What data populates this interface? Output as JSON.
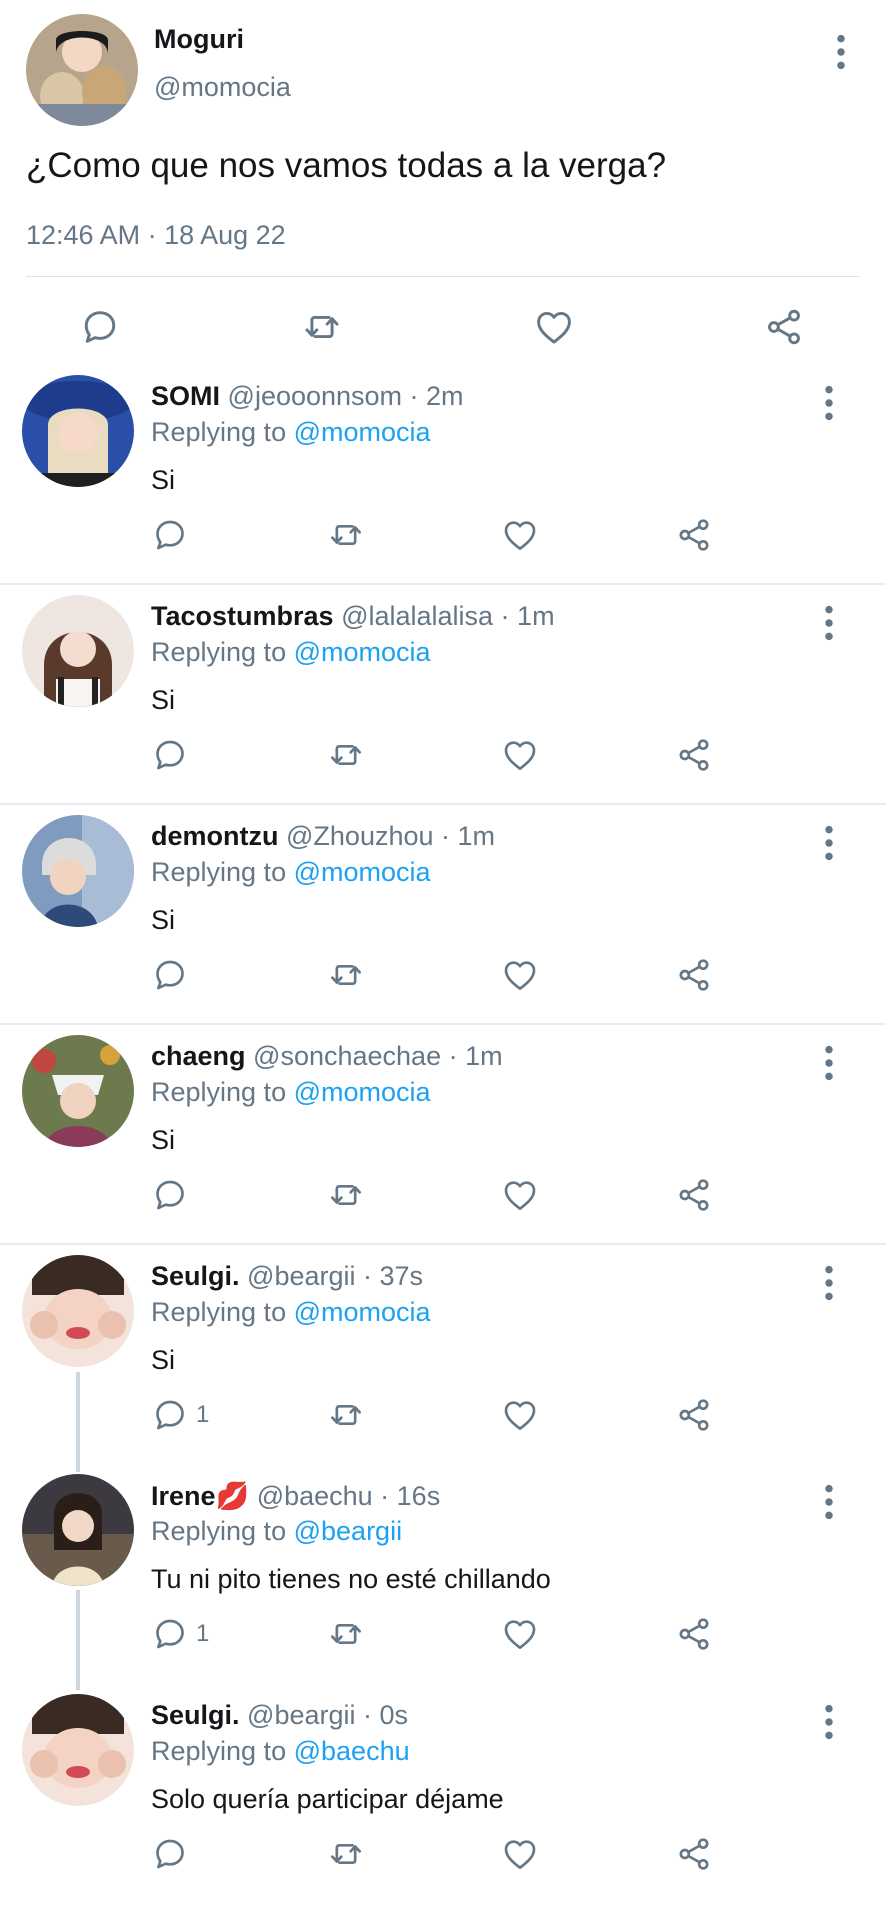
{
  "main_tweet": {
    "name": "Moguri",
    "handle": "@momocia",
    "text": "¿Como que nos vamos todas a la verga?",
    "timestamp": "12:46 AM · 18 Aug 22",
    "icons": [
      "comment-icon",
      "retweet-icon",
      "like-icon",
      "share-icon",
      "more-options-icon"
    ]
  },
  "replying_prefix": "Replying to",
  "replies": [
    {
      "name": "SOMI",
      "meta": "@jeooonnsom · 2m",
      "replying_to": "@momocia",
      "text": "Si",
      "comment_count": ""
    },
    {
      "name": "Tacostumbras",
      "meta": "@lalalalalisa · 1m",
      "replying_to": "@momocia",
      "text": "Si",
      "comment_count": ""
    },
    {
      "name": "demontzu",
      "meta": "@Zhouzhou · 1m",
      "replying_to": "@momocia",
      "text": "Si",
      "comment_count": ""
    },
    {
      "name": "chaeng",
      "meta": "@sonchaechae · 1m",
      "replying_to": "@momocia",
      "text": "Si",
      "comment_count": ""
    },
    {
      "name": "Seulgi.",
      "meta": "@beargii · 37s",
      "replying_to": "@momocia",
      "text": "Si",
      "comment_count": "1"
    },
    {
      "name": "Irene",
      "name_emoji": "💋",
      "meta": "@baechu · 16s",
      "replying_to": "@beargii",
      "text": "Tu ni pito tienes no esté chillando",
      "comment_count": "1"
    },
    {
      "name": "Seulgi.",
      "meta": "@beargii · 0s",
      "replying_to": "@baechu",
      "text": "Solo quería participar déjame",
      "comment_count": ""
    }
  ],
  "colors": {
    "link": "#1da1f2",
    "secondary": "#657786",
    "text": "#14171a",
    "icon": "#657786",
    "divider": "#e6ecf0",
    "thread_line": "#ccd6dd"
  }
}
